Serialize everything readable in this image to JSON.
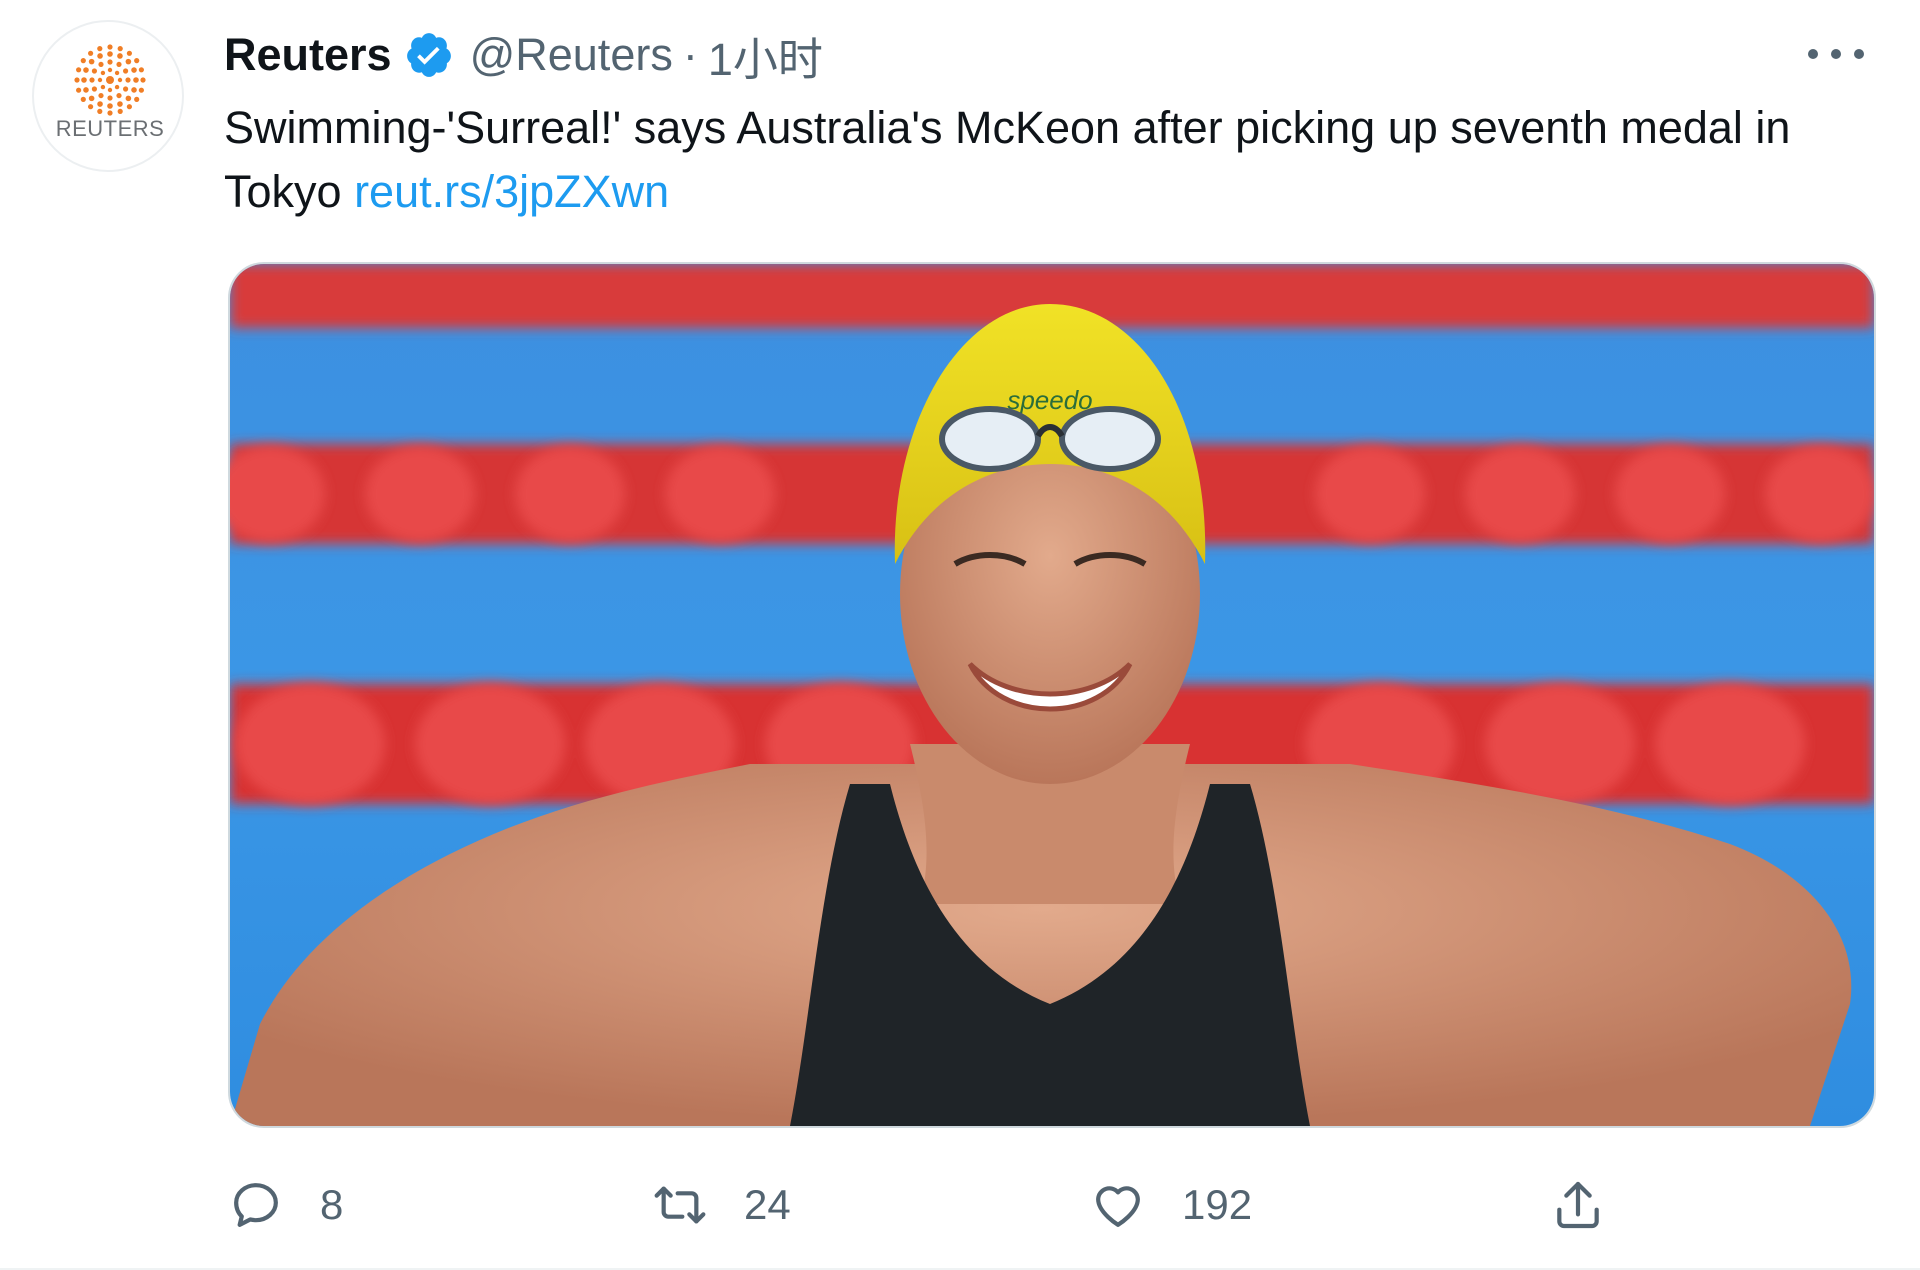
{
  "account": {
    "display_name": "Reuters",
    "handle": "@Reuters",
    "separator": "·",
    "timestamp": "1小时",
    "avatar_label": "REUTERS",
    "verified_icon": "verified-badge-icon"
  },
  "tweet": {
    "text": "Swimming-'Surreal!' says Australia's McKeon after picking up seventh medal in Tokyo ",
    "link": "reut.rs/3jpZXwn"
  },
  "media": {
    "description_icon": "photo-image",
    "cap_brand": "speedo"
  },
  "actions": {
    "reply": {
      "icon": "reply-icon",
      "count": "8"
    },
    "retweet": {
      "icon": "retweet-icon",
      "count": "24"
    },
    "like": {
      "icon": "heart-icon",
      "count": "192"
    },
    "share": {
      "icon": "share-icon"
    }
  },
  "colors": {
    "link": "#1d9bf0",
    "verified": "#1d9bf0",
    "secondary_text": "#536471",
    "reuters_orange": "#f07e26"
  }
}
